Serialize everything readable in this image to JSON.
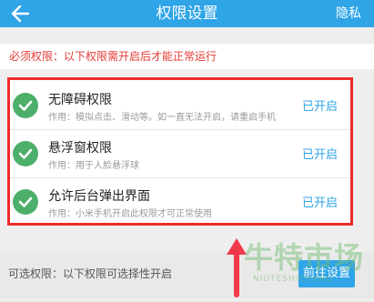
{
  "header": {
    "back_icon": "back-arrow-icon",
    "title": "权限设置",
    "privacy_label": "隐私"
  },
  "notice": {
    "text": "必须权限：以下权限需开启后才能正常运行"
  },
  "permissions": [
    {
      "icon": "check-circle-icon",
      "name": "无障碍权限",
      "desc": "作用：模拟点击、滑动等。如一直无法开启，请重启手机",
      "status": "已开启"
    },
    {
      "icon": "check-circle-icon",
      "name": "悬浮窗权限",
      "desc": "作用：用于人脸悬浮球",
      "status": "已开启"
    },
    {
      "icon": "check-circle-icon",
      "name": "允许后台弹出界面",
      "desc": "作用：小米手机开启此权限才可正常使用",
      "status": "已开启"
    }
  ],
  "optional": {
    "text": "可选权限：以下权限可选择性开启",
    "button_label": "前往设置"
  },
  "watermark": {
    "text_cn": "牛特市场",
    "text_en": "NIUTESHICHANG"
  },
  "colors": {
    "header_bg": "#2fa4e7",
    "accent_blue": "#2fa4e7",
    "notice_red": "#e53935",
    "highlight_border": "#ef2b2b",
    "check_green": "#4caf6a"
  }
}
